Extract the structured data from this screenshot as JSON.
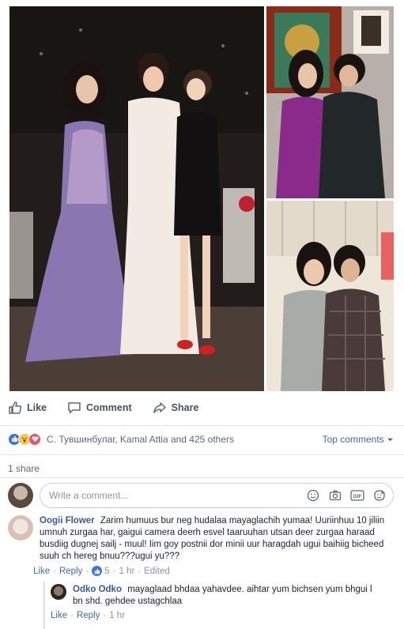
{
  "post": {
    "actions": {
      "like": "Like",
      "comment": "Comment",
      "share": "Share"
    },
    "reactions": {
      "summary": "С. Тувшинбулаг, Kamal Attia and 425 others",
      "sort_label": "Top comments"
    },
    "shares": "1 share"
  },
  "composer": {
    "placeholder": "Write a comment..."
  },
  "comments": [
    {
      "author": "Oogii Flower",
      "text": "Zarim humuus bur neg hudalaa mayaglachih yumaa! Uuriinhuu 10 jiliin umnuh zurgaa har, gaigui camera deerh esvel taaruuhan utsan deer zurgaa haraad busdiig dugnej sailj - muul! Iim goy postnii dor minii uur haragdah ugui baihiig bicheed suuh ch hereg bnuu???ugui yu???",
      "like": "Like",
      "reply": "Reply",
      "likes": "5",
      "time": "1 hr",
      "edited": "Edited"
    },
    {
      "author": "Odko Odko",
      "text": "mayaglaad bhdaa yahavdee. aihtar yum bichsen yum bhgui l bn shd. gehdee ustagchlaa",
      "like": "Like",
      "reply": "Reply",
      "time": "1 hr"
    }
  ]
}
